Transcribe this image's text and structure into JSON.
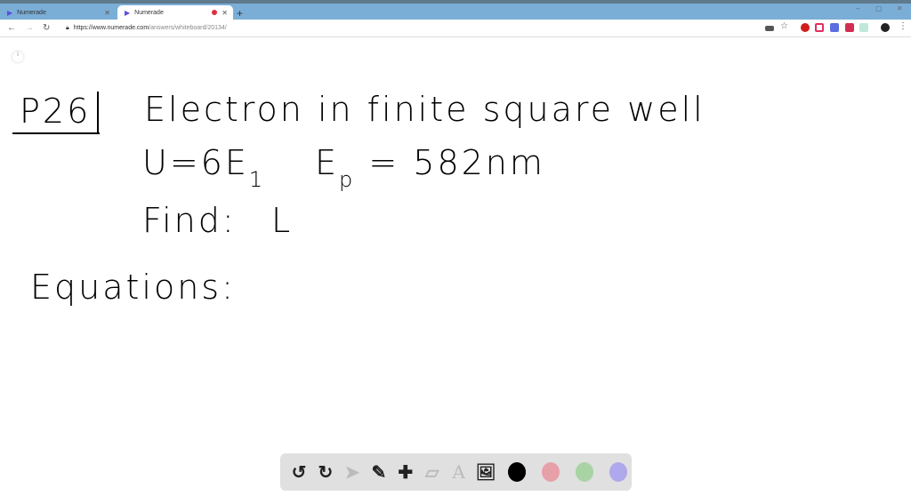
{
  "browser": {
    "tabs": [
      {
        "label": "Numerade",
        "active": false
      },
      {
        "label": "Numerade",
        "active": true,
        "recording": true
      }
    ],
    "new_tab": "+",
    "window_controls": [
      "–",
      "▢",
      "✕"
    ],
    "url_host": "https://www.numerade.com",
    "url_path": "/answers/whiteboard/20134/"
  },
  "whiteboard": {
    "problem": "P26",
    "title": "Electron in finite square well",
    "given_u": "U=6E",
    "given_u_sub": "1",
    "given_e": "E",
    "given_e_sub": "p",
    "given_e_val": "= 582nm",
    "find_label": "Find:",
    "find_var": "L",
    "equations_label": "Equations:"
  },
  "toolbar": {
    "tools": [
      "undo",
      "redo",
      "select",
      "pen",
      "add",
      "eraser",
      "text",
      "image"
    ],
    "colors": [
      "#000000",
      "#e8a0a8",
      "#a8d4a4",
      "#b0a8ec"
    ]
  }
}
